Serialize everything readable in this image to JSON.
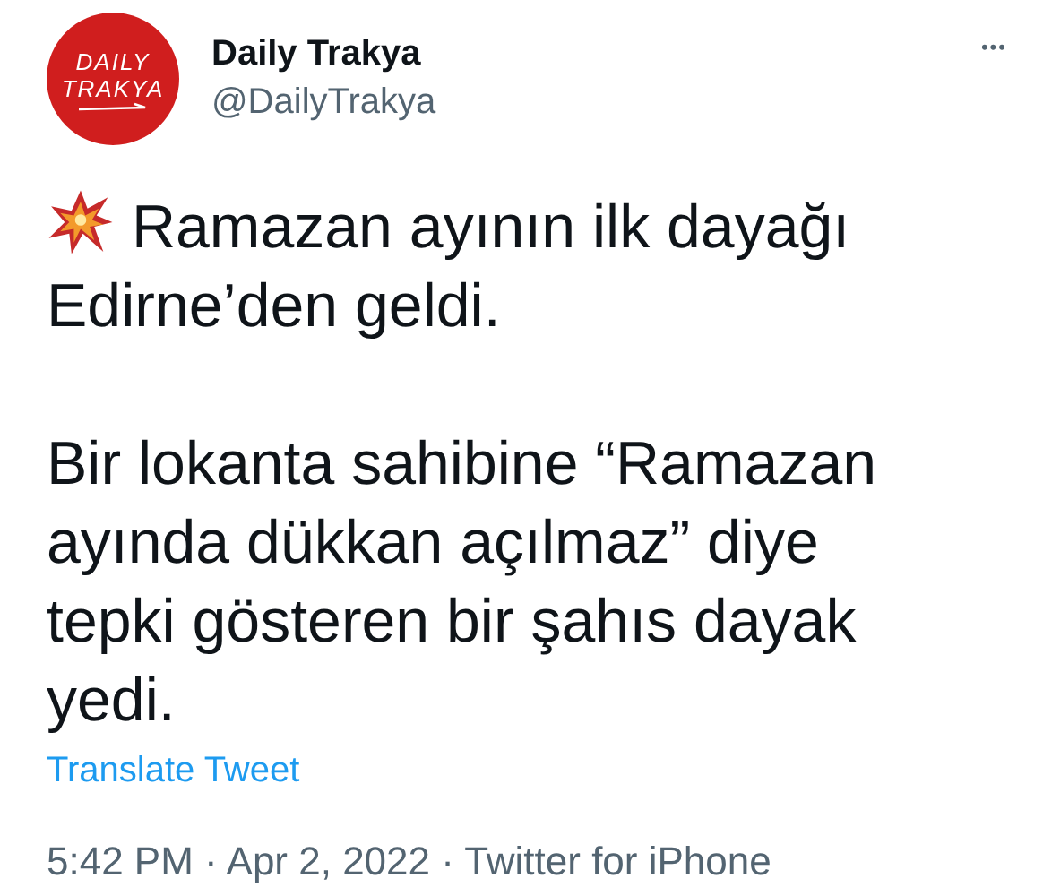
{
  "author": {
    "avatar_lines": [
      "DAILY",
      "TRAKYA"
    ],
    "name": "Daily Trakya",
    "handle": "@DailyTrakya",
    "more": "•••"
  },
  "paragraphs": [
    {
      "kind": "emoji_lead",
      "text": "Ramazan ayının ilk dayağı\nEdirne’den geldi."
    },
    {
      "kind": "plain",
      "text": "Bir lokanta sahibine “Ramazan\nayında dükkan açılmaz” diye\ntepki gösteren bir şahıs dayak\nyedi."
    }
  ],
  "translate": "Translate Tweet",
  "meta": "5:42 PM · Apr 2, 2022 · Twitter for iPhone"
}
